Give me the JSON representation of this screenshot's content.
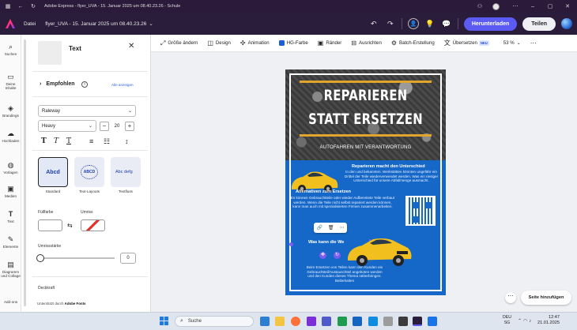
{
  "browser": {
    "title": "Adobe Express - flyer_UVA - 15. Januar 2025 um 08.40.23.26 - Schule"
  },
  "appbar": {
    "file_menu": "Datei",
    "doc_title": "flyer_UVA - 15. Januar 2025 um 08.40.23.26",
    "download_label": "Herunterladen",
    "share_label": "Teilen",
    "brand_color": "#5b5bf3"
  },
  "rail": {
    "items": [
      {
        "label": "Suchen",
        "icon": "search-icon"
      },
      {
        "label": "Deine Inhalte",
        "icon": "folder-icon"
      },
      {
        "label": "Brandings",
        "icon": "brand-icon"
      },
      {
        "label": "Hochladen",
        "icon": "upload-icon"
      },
      {
        "label": "Vorlagen",
        "icon": "templates-icon"
      },
      {
        "label": "Medien",
        "icon": "media-icon"
      },
      {
        "label": "Text",
        "icon": "text-icon"
      },
      {
        "label": "Elemente",
        "icon": "elements-icon"
      },
      {
        "label": "Diagramm und Collage",
        "icon": "chart-icon"
      },
      {
        "label": "Add-ons",
        "icon": "addons-icon"
      }
    ]
  },
  "panel": {
    "title": "Text",
    "recommended_label": "Empfohlen",
    "show_all_label": "Alle anzeigen",
    "font_family": "Raleway",
    "font_weight": "Heavy",
    "font_size": "20",
    "styles": [
      {
        "label": "Standard",
        "preview": "Abcd"
      },
      {
        "label": "Text-Layouts",
        "preview": "ABCD"
      },
      {
        "label": "Textfluss",
        "preview": "Abc defg"
      }
    ],
    "fill_label": "Füllfarbe",
    "outline_label": "Umriss",
    "outline_thickness_label": "Umrissstärke",
    "outline_thickness_value": "0",
    "opacity_label": "Deckkraft",
    "powered_by_prefix": "Unterstützt durch",
    "powered_by_brand": "Adobe Fonts"
  },
  "toolbar": {
    "items": [
      {
        "label": "Größe ändern",
        "icon": "resize-icon"
      },
      {
        "label": "Design",
        "icon": "design-icon"
      },
      {
        "label": "Animation",
        "icon": "animation-icon"
      },
      {
        "label": "HG-Farbe",
        "icon": "bg-color-icon"
      },
      {
        "label": "Ränder",
        "icon": "borders-icon"
      },
      {
        "label": "Ausrichten",
        "icon": "align-icon"
      },
      {
        "label": "Batch-Erstellung",
        "icon": "batch-icon"
      },
      {
        "label": "Übersetzen",
        "icon": "translate-icon"
      }
    ],
    "new_badge": "NEU",
    "zoom": "53 %"
  },
  "flyer": {
    "headline_1": "REPARIEREN",
    "headline_2": "STATT ERSETZEN",
    "subheadline": "AUTOFAHREN MIT VERANTWORTUNG",
    "section1_title": "Reparieren macht den Unterschied",
    "section1_text": "In den und bekannten. Werkstätten könnten ungefähr ein Drittel der Teile wiederverwendet werden. Was ein riesiger Unterschied für unsere Abfallmenge ausmacht.",
    "section2_title": "Alternativen zum Ersetzen",
    "section2_text": "Es können Gebrauchtteile oder wieder Aufbereitete Teile verbaut werden. Wenn die Teile nicht selbst repariert werden können, kann man auch mit spezialisierten Firmen zusammenarbeiten.",
    "section3_title": "Was kann die We",
    "section3_text": "Beim Ersetzen von Teilen kann den Kunden ein Gebrauchtteil/Austauschteil angeboten werden und den Kunden dieses Thema näherbringen. Beibehalten",
    "accent_color": "#e0a52a",
    "blue_color": "#1568c8"
  },
  "canvas": {
    "add_page_label": "Seite hinzufügen"
  },
  "taskbar": {
    "search_placeholder": "Suche",
    "lang": "DEU",
    "lang_sub": "SG",
    "time": "12:47",
    "date": "21.01.2025"
  }
}
